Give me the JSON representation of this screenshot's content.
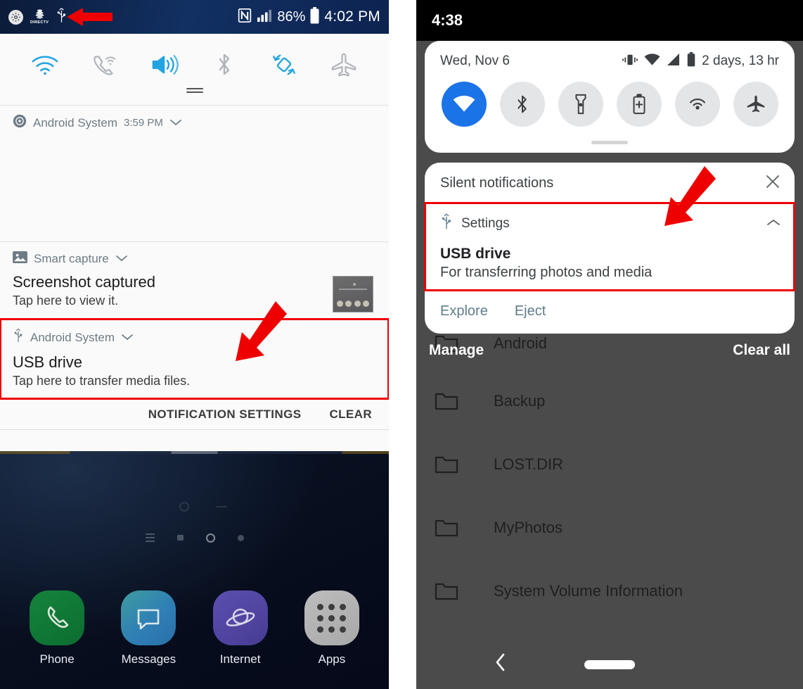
{
  "left_phone": {
    "status_bar": {
      "icons": [
        "gear-icon",
        "directv-icon",
        "usb-icon"
      ],
      "directv_label": "DIRECTV",
      "nfc_label": "N",
      "battery_percent": "86%",
      "time": "4:02 PM"
    },
    "quick_settings": [
      {
        "name": "wifi",
        "label": "Wi-Fi",
        "active": true
      },
      {
        "name": "wifi-calling",
        "label": "Wi-Fi calling",
        "active": false
      },
      {
        "name": "sound",
        "label": "Sound",
        "active": true
      },
      {
        "name": "bluetooth",
        "label": "Bluetooth",
        "active": false
      },
      {
        "name": "auto-rotate",
        "label": "Auto rotate",
        "active": true
      },
      {
        "name": "airplane-mode",
        "label": "Airplane mode",
        "active": false
      }
    ],
    "notifications": [
      {
        "app": "Android System",
        "time": "3:59 PM",
        "title": "",
        "body": ""
      },
      {
        "app": "Smart capture",
        "time": "",
        "title": "Screenshot captured",
        "body": "Tap here to view it."
      },
      {
        "app": "Android System",
        "time": "",
        "title": "USB drive",
        "body": "Tap here to transfer media files.",
        "highlighted": true
      }
    ],
    "footer_actions": {
      "notification_settings": "NOTIFICATION SETTINGS",
      "clear": "CLEAR"
    },
    "home_dock": [
      {
        "label": "Phone",
        "icon": "phone-icon"
      },
      {
        "label": "Messages",
        "icon": "message-icon"
      },
      {
        "label": "Internet",
        "icon": "planet-icon"
      },
      {
        "label": "Apps",
        "icon": "apps-grid-icon"
      }
    ]
  },
  "right_phone": {
    "status_bar": {
      "time": "4:38"
    },
    "quick_settings": {
      "date": "Wed, Nov 6",
      "battery_estimate": "2 days, 13 hr",
      "status_icons": [
        "vibrate-icon",
        "wifi-icon",
        "signal-icon",
        "battery-icon"
      ],
      "tiles": [
        {
          "name": "wifi",
          "label": "Wi-Fi",
          "active": true
        },
        {
          "name": "bluetooth",
          "label": "Bluetooth",
          "active": false
        },
        {
          "name": "flashlight",
          "label": "Flashlight",
          "active": false
        },
        {
          "name": "battery-saver",
          "label": "Battery Saver",
          "active": false
        },
        {
          "name": "hotspot",
          "label": "Hotspot",
          "active": false
        },
        {
          "name": "airplane-mode",
          "label": "Airplane mode",
          "active": false
        }
      ]
    },
    "silent_header": "Silent notifications",
    "usb_notification": {
      "app": "Settings",
      "title": "USB drive",
      "body": "For transferring photos and media",
      "actions": [
        "Explore",
        "Eject"
      ],
      "highlighted": true
    },
    "shade_footer": {
      "manage": "Manage",
      "clear_all": "Clear all"
    },
    "file_list": [
      {
        "name": "Android",
        "icon": "folder-icon"
      },
      {
        "name": "Backup",
        "icon": "folder-icon"
      },
      {
        "name": "LOST.DIR",
        "icon": "folder-icon"
      },
      {
        "name": "MyPhotos",
        "icon": "folder-icon"
      },
      {
        "name": "System Volume Information",
        "icon": "folder-icon"
      }
    ],
    "nav_bar": {
      "back": "back-icon",
      "home": "home-pill-icon"
    }
  },
  "annotations": {
    "accent_color": "#ee0000",
    "arrows": [
      {
        "name": "arrow-to-usb-status-icon",
        "direction": "left"
      },
      {
        "name": "arrow-to-usb-notification-left",
        "direction": "down-left"
      },
      {
        "name": "arrow-to-usb-notification-right",
        "direction": "down-left"
      }
    ]
  }
}
